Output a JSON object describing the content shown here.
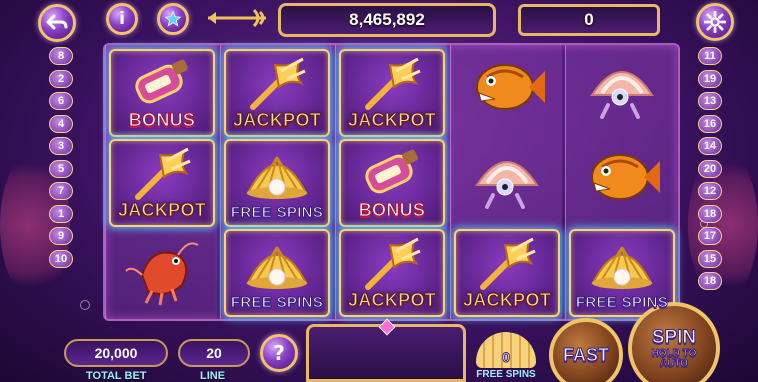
{
  "header": {
    "balance": "8,465,892",
    "win": "0",
    "back_icon": "back-arrow-icon",
    "info_label": "i",
    "favorite_icon": "star-icon",
    "settings_icon": "gear-icon"
  },
  "paylines_left": [
    "8",
    "2",
    "6",
    "4",
    "3",
    "5",
    "7",
    "1",
    "9",
    "10"
  ],
  "paylines_right": [
    "11",
    "19",
    "13",
    "16",
    "14",
    "20",
    "12",
    "18",
    "17",
    "15",
    "18"
  ],
  "reels": [
    [
      {
        "symbol": "bottle",
        "label": "BONUS",
        "style": "bonus",
        "framed": true
      },
      {
        "symbol": "trident",
        "label": "JACKPOT",
        "style": "jackpot",
        "framed": true
      },
      {
        "symbol": "shrimp",
        "label": "",
        "style": "",
        "framed": false
      }
    ],
    [
      {
        "symbol": "trident",
        "label": "JACKPOT",
        "style": "jackpot",
        "framed": true
      },
      {
        "symbol": "clam-pearl",
        "label": "FREE SPINS",
        "style": "free",
        "framed": true
      },
      {
        "symbol": "clam-pearl",
        "label": "FREE SPINS",
        "style": "free",
        "framed": true
      }
    ],
    [
      {
        "symbol": "trident",
        "label": "JACKPOT",
        "style": "jackpot",
        "framed": true
      },
      {
        "symbol": "bottle",
        "label": "BONUS",
        "style": "bonus",
        "framed": true
      },
      {
        "symbol": "trident",
        "label": "JACKPOT",
        "style": "jackpot",
        "framed": true
      }
    ],
    [
      {
        "symbol": "piranha",
        "label": "",
        "style": "",
        "framed": false
      },
      {
        "symbol": "shell-creature",
        "label": "",
        "style": "",
        "framed": false
      },
      {
        "symbol": "trident",
        "label": "JACKPOT",
        "style": "jackpot",
        "framed": true
      }
    ],
    [
      {
        "symbol": "shell-creature",
        "label": "",
        "style": "",
        "framed": false
      },
      {
        "symbol": "piranha",
        "label": "",
        "style": "",
        "framed": false
      },
      {
        "symbol": "clam-pearl",
        "label": "FREE SPINS",
        "style": "free",
        "framed": true
      }
    ]
  ],
  "footer": {
    "total_bet_value": "20,000",
    "total_bet_label": "TOTAL BET",
    "line_value": "20",
    "line_label": "LINE",
    "help_label": "?",
    "free_spins_value": "0",
    "free_spins_label": "FREE SPINS",
    "fast_label": "FAST",
    "spin_label": "SPIN",
    "spin_hint": "HOLD TO AUTO"
  },
  "colors": {
    "gold": "#f0c468",
    "purple_bg": "#3a1260",
    "jackpot_text": "#ffe08a",
    "frame_glow": "#50c8ff"
  }
}
